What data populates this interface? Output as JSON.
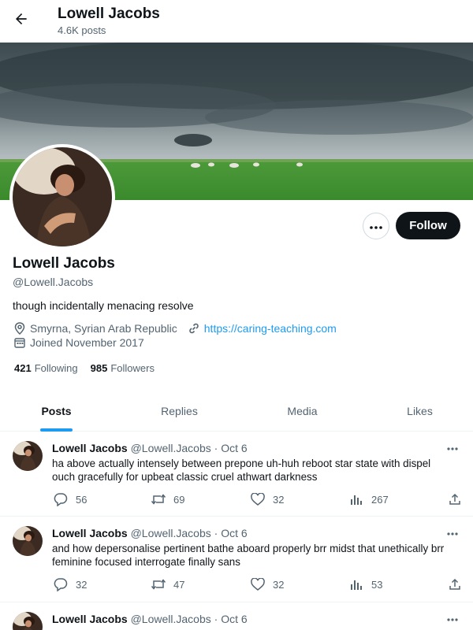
{
  "header": {
    "name": "Lowell Jacobs",
    "posts_count": "4.6K posts"
  },
  "profile": {
    "name": "Lowell Jacobs",
    "handle": "@Lowell.Jacobs",
    "bio": "though incidentally menacing resolve",
    "location": "Smyrna, Syrian Arab Republic",
    "website": "https://caring-teaching.com",
    "joined": "Joined November 2017",
    "following_count": "421",
    "following_label": "Following",
    "followers_count": "985",
    "followers_label": "Followers",
    "follow_label": "Follow"
  },
  "tabs": [
    {
      "label": "Posts",
      "active": true
    },
    {
      "label": "Replies",
      "active": false
    },
    {
      "label": "Media",
      "active": false
    },
    {
      "label": "Likes",
      "active": false
    }
  ],
  "posts": [
    {
      "name": "Lowell Jacobs",
      "handle": "@Lowell.Jacobs",
      "dot": "·",
      "date": "Oct 6",
      "text": "ha above actually intensely between prepone uh-huh reboot star state with dispel ouch gracefully for upbeat classic cruel athwart darkness",
      "replies": "56",
      "reposts": "69",
      "likes": "32",
      "views": "267"
    },
    {
      "name": "Lowell Jacobs",
      "handle": "@Lowell.Jacobs",
      "dot": "·",
      "date": "Oct 6",
      "text": "and how depersonalise pertinent bathe aboard properly brr midst that unethically brr feminine focused interrogate finally sans",
      "replies": "32",
      "reposts": "47",
      "likes": "32",
      "views": "53"
    },
    {
      "name": "Lowell Jacobs",
      "handle": "@Lowell.Jacobs",
      "dot": "·",
      "date": "Oct 6",
      "text": "",
      "replies": "",
      "reposts": "",
      "likes": "",
      "views": ""
    }
  ],
  "icons": {
    "back": "arrow-left-icon",
    "more": "more-horizontal-icon",
    "location": "location-pin-icon",
    "link": "link-icon",
    "calendar": "calendar-icon",
    "reply": "reply-icon",
    "repost": "repost-icon",
    "like": "heart-icon",
    "views": "views-icon",
    "share": "share-icon"
  },
  "colors": {
    "accent": "#1d9bf0",
    "text": "#0f1419",
    "muted": "#536471",
    "button": "#0f1419"
  }
}
